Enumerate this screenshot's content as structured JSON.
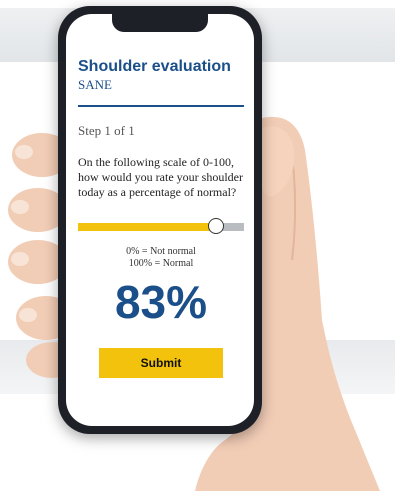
{
  "screen": {
    "title": "Shoulder evaluation",
    "subtitle": "SANE",
    "step": "Step 1 of 1",
    "question": "On the following scale of 0-100, how would you rate your shoulder today as a percentage of normal?",
    "slider": {
      "value": 83,
      "min": 0,
      "max": 100,
      "fill_color": "#f2c20c",
      "track_color": "#b9bcc0"
    },
    "legend_min": "0% = Not normal",
    "legend_max": "100% = Normal",
    "percent_display": "83%",
    "submit_label": "Submit"
  },
  "colors": {
    "brand_blue": "#1b4f8a",
    "accent_yellow": "#f2c20c",
    "phone_frame": "#1d2027"
  }
}
